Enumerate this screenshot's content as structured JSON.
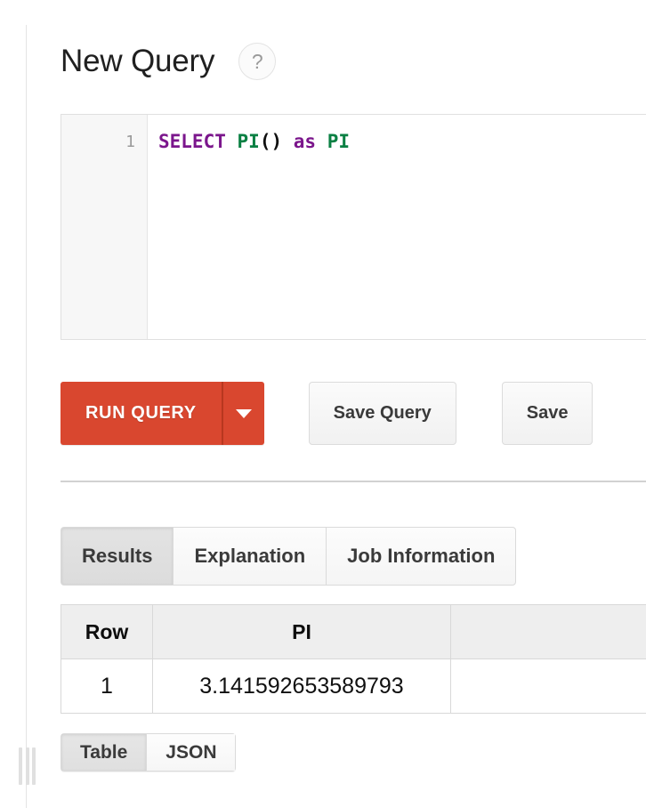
{
  "header": {
    "title": "New Query",
    "help_icon": "question-mark-icon",
    "help_glyph": "?"
  },
  "editor": {
    "line_numbers": [
      "1"
    ],
    "query_text": "SELECT PI() as PI",
    "tokens": [
      {
        "text": "SELECT",
        "type": "keyword",
        "color": "#7b168c"
      },
      {
        "text": " ",
        "type": "space"
      },
      {
        "text": "PI",
        "type": "function",
        "color": "#0b8043"
      },
      {
        "text": "()",
        "type": "punctuation",
        "color": "#101010"
      },
      {
        "text": " ",
        "type": "space"
      },
      {
        "text": "as",
        "type": "keyword",
        "color": "#7b168c"
      },
      {
        "text": " ",
        "type": "space"
      },
      {
        "text": "PI",
        "type": "identifier",
        "color": "#0b8043"
      }
    ]
  },
  "actions": {
    "run_label": "RUN QUERY",
    "run_color": "#d9472f",
    "run_caret_icon": "chevron-down-icon",
    "save_query_label": "Save Query",
    "save_truncated_label": "Save"
  },
  "tabs": [
    {
      "label": "Results",
      "active": true
    },
    {
      "label": "Explanation",
      "active": false
    },
    {
      "label": "Job Information",
      "active": false
    }
  ],
  "results": {
    "columns": [
      "Row",
      "PI",
      ""
    ],
    "rows": [
      {
        "row": "1",
        "pi": "3.141592653589793",
        "pad": ""
      }
    ]
  },
  "format_toggle": [
    {
      "label": "Table",
      "active": true
    },
    {
      "label": "JSON",
      "active": false
    }
  ],
  "splitter": {
    "handle_icon": "drag-handle-icon"
  }
}
